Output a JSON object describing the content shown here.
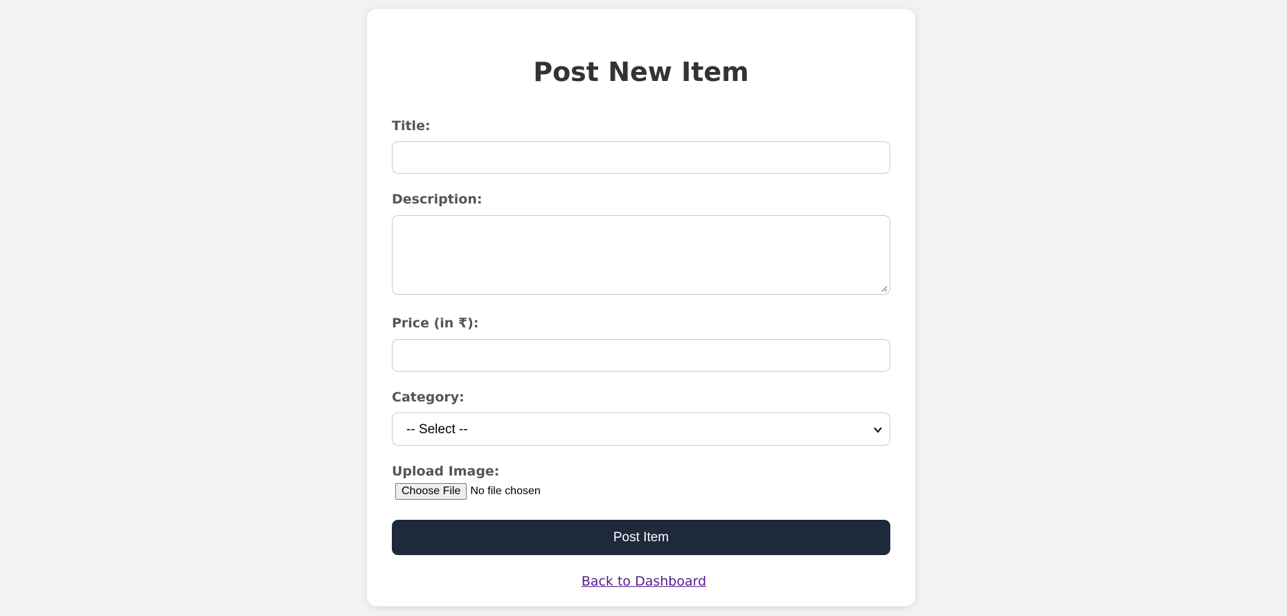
{
  "form": {
    "title": "Post New Item",
    "title_label": "Title:",
    "title_value": "",
    "description_label": "Description:",
    "description_value": "",
    "price_label": "Price (in ₹):",
    "price_value": "",
    "category_label": "Category:",
    "category_selected": "-- Select --",
    "upload_label": "Upload Image:",
    "choose_file_label": "Choose File",
    "file_status": "No file chosen",
    "submit_label": "Post Item",
    "back_link_label": "Back to Dashboard"
  },
  "colors": {
    "background": "#f2f2f2",
    "card": "#ffffff",
    "button": "#1e293b",
    "link": "#551a8b"
  }
}
